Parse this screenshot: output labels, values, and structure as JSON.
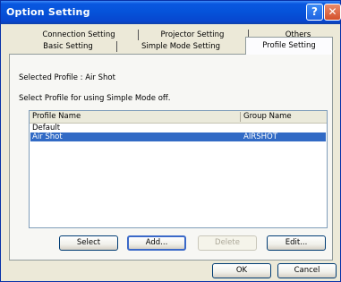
{
  "window": {
    "title": "Option Setting",
    "help_glyph": "?",
    "close_glyph": "✕"
  },
  "tabs": {
    "row_back": [
      "Connection Setting",
      "Projector Setting",
      "Others"
    ],
    "row_front": [
      "Basic Setting",
      "Simple Mode Setting",
      "Profile Setting"
    ],
    "active": "Profile Setting"
  },
  "panel": {
    "selected_profile_label": "Selected Profile : Air Shot",
    "instruction": "Select Profile for using Simple Mode off.",
    "list": {
      "columns": [
        "Profile Name",
        "Group Name"
      ],
      "rows": [
        {
          "profile": "Default",
          "group": "",
          "selected": false
        },
        {
          "profile": "Air Shot",
          "group": "AIRSHOT",
          "selected": true
        }
      ]
    },
    "buttons": {
      "select": "Select",
      "add": "Add...",
      "delete": "Delete",
      "edit": "Edit..."
    }
  },
  "footer": {
    "ok": "OK",
    "cancel": "Cancel"
  },
  "colors": {
    "title_bar": "#0552d9",
    "selection": "#316ac5"
  }
}
